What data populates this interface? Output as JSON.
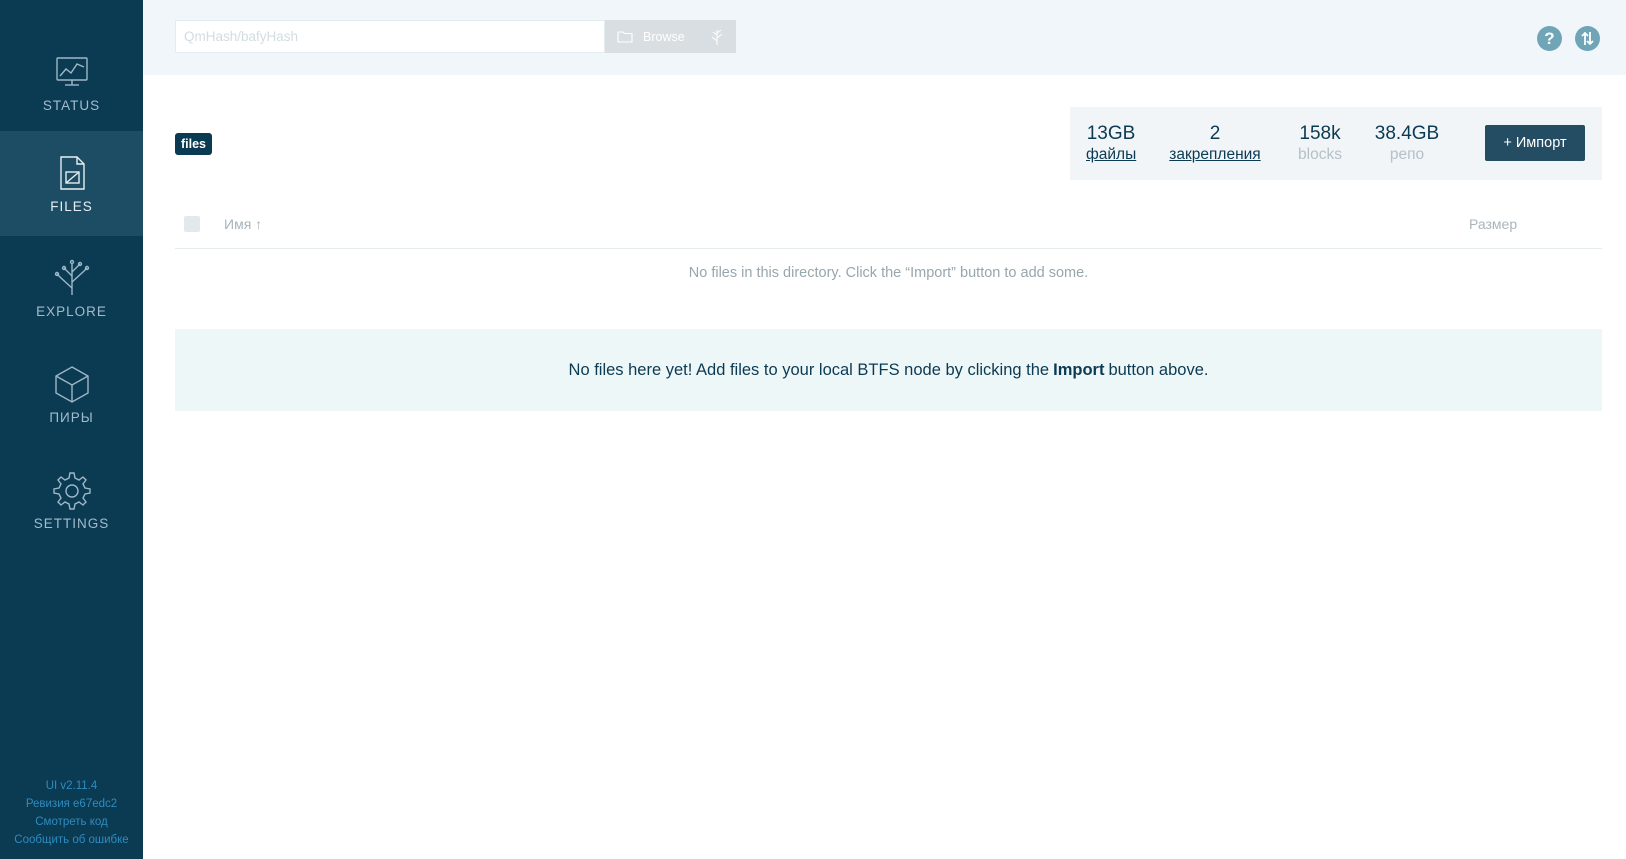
{
  "sidebar": {
    "items": [
      {
        "label": "STATUS",
        "icon": "status-chart-icon"
      },
      {
        "label": "FILES",
        "icon": "files-icon",
        "active": true
      },
      {
        "label": "EXPLORE",
        "icon": "explore-tree-icon"
      },
      {
        "label": "ПИРЫ",
        "icon": "peers-cube-icon"
      },
      {
        "label": "SETTINGS",
        "icon": "settings-gear-icon"
      }
    ],
    "footer": {
      "version": "UI v2.11.4",
      "revision": "Ревизия e67edc2",
      "view_code": "Смотреть код",
      "report_bug": "Сообщить об ошибке"
    }
  },
  "topbar": {
    "search_placeholder": "QmHash/bafyHash",
    "search_value": "",
    "browse_label": "Browse"
  },
  "files": {
    "breadcrumb": "files",
    "stats": {
      "files_value": "13GB",
      "files_label": "файлы",
      "pins_value": "2",
      "pins_label": "закрепления",
      "blocks_value": "158k",
      "blocks_label": "blocks",
      "repo_value": "38.4GB",
      "repo_label": "репо"
    },
    "import_label": "+ Импорт",
    "table": {
      "name_header": "Имя ↑",
      "size_header": "Размер"
    },
    "empty_directory": "No files in this directory. Click the “Import” button to add some.",
    "notice": {
      "before": "No files here yet! Add files to your local BTFS node by clicking the",
      "bold": "Import",
      "after": "button above."
    }
  },
  "colors": {
    "sidebar_bg": "#0b3a53",
    "sidebar_active": "#1d4d65",
    "accent": "#244c63",
    "notice_bg": "#eef7f7"
  }
}
